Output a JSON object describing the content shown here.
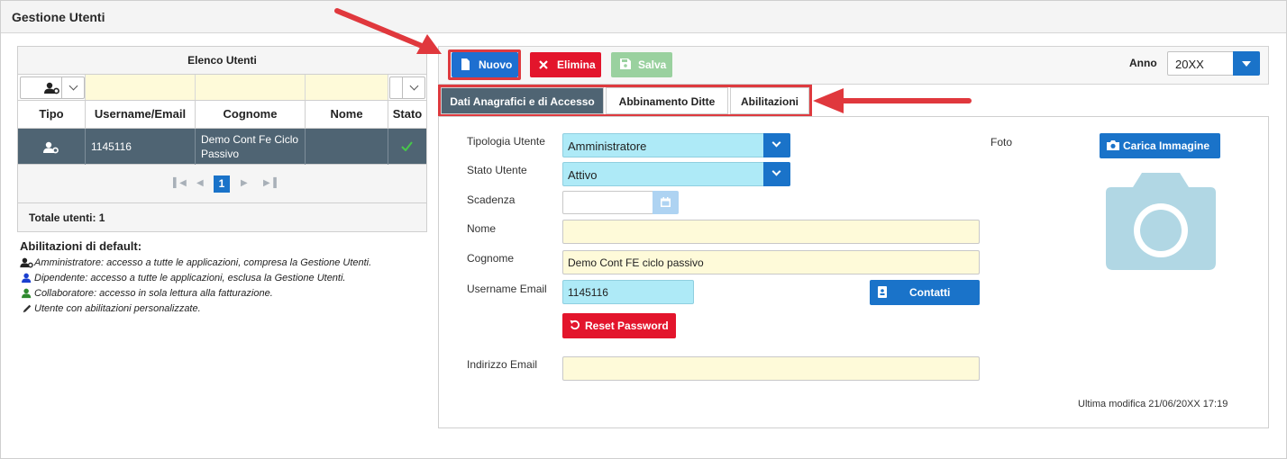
{
  "page": {
    "title": "Gestione Utenti"
  },
  "users_panel": {
    "title": "Elenco Utenti",
    "columns": [
      "Tipo",
      "Username/Email",
      "Cognome",
      "Nome",
      "Stato"
    ],
    "rows": [
      {
        "tipo_icon": "admin-user-icon",
        "username": "1145116",
        "cognome": "Demo Cont Fe Ciclo Passivo",
        "nome": "",
        "stato_icon": "check-icon"
      }
    ],
    "pager": {
      "current": "1"
    },
    "total": "Totale utenti: 1"
  },
  "defaults": {
    "title": "Abilitazioni di default:",
    "lines": [
      {
        "icon": "admin-user-icon",
        "text": "Amministratore: accesso a tutte le applicazioni, compresa la Gestione Utenti."
      },
      {
        "icon": "employee-user-icon",
        "text": "Dipendente: accesso a tutte le applicazioni, esclusa la Gestione Utenti."
      },
      {
        "icon": "collaborator-user-icon",
        "text": "Collaboratore: accesso in sola lettura alla fatturazione."
      },
      {
        "icon": "pencil-icon",
        "text": "Utente con abilitazioni personalizzate."
      }
    ]
  },
  "toolbar": {
    "nuovo": "Nuovo",
    "elimina": "Elimina",
    "salva": "Salva",
    "anno_label": "Anno",
    "anno_value": "20XX"
  },
  "tabs": [
    "Dati Anagrafici e di Accesso",
    "Abbinamento Ditte",
    "Abilitazioni"
  ],
  "form": {
    "tipologia_label": "Tipologia Utente",
    "tipologia_value": "Amministratore",
    "stato_label": "Stato Utente",
    "stato_value": "Attivo",
    "scadenza_label": "Scadenza",
    "scadenza_value": "",
    "nome_label": "Nome",
    "nome_value": "",
    "cognome_label": "Cognome",
    "cognome_value": "Demo Cont FE ciclo passivo",
    "username_label": "Username Email",
    "username_value": "1145116",
    "contatti_button": "Contatti",
    "reset_button": "Reset Password",
    "email_label": "Indirizzo Email",
    "email_value": "",
    "foto_label": "Foto",
    "carica_button": "Carica Immagine",
    "last_modified": "Ultima modifica 21/06/20XX 17:19"
  },
  "colors": {
    "accent_blue": "#1a73c9",
    "danger_red": "#e3152c",
    "save_green": "#9ad19f",
    "selected_row": "#4f6473",
    "annotation_red": "#de3a3f"
  }
}
